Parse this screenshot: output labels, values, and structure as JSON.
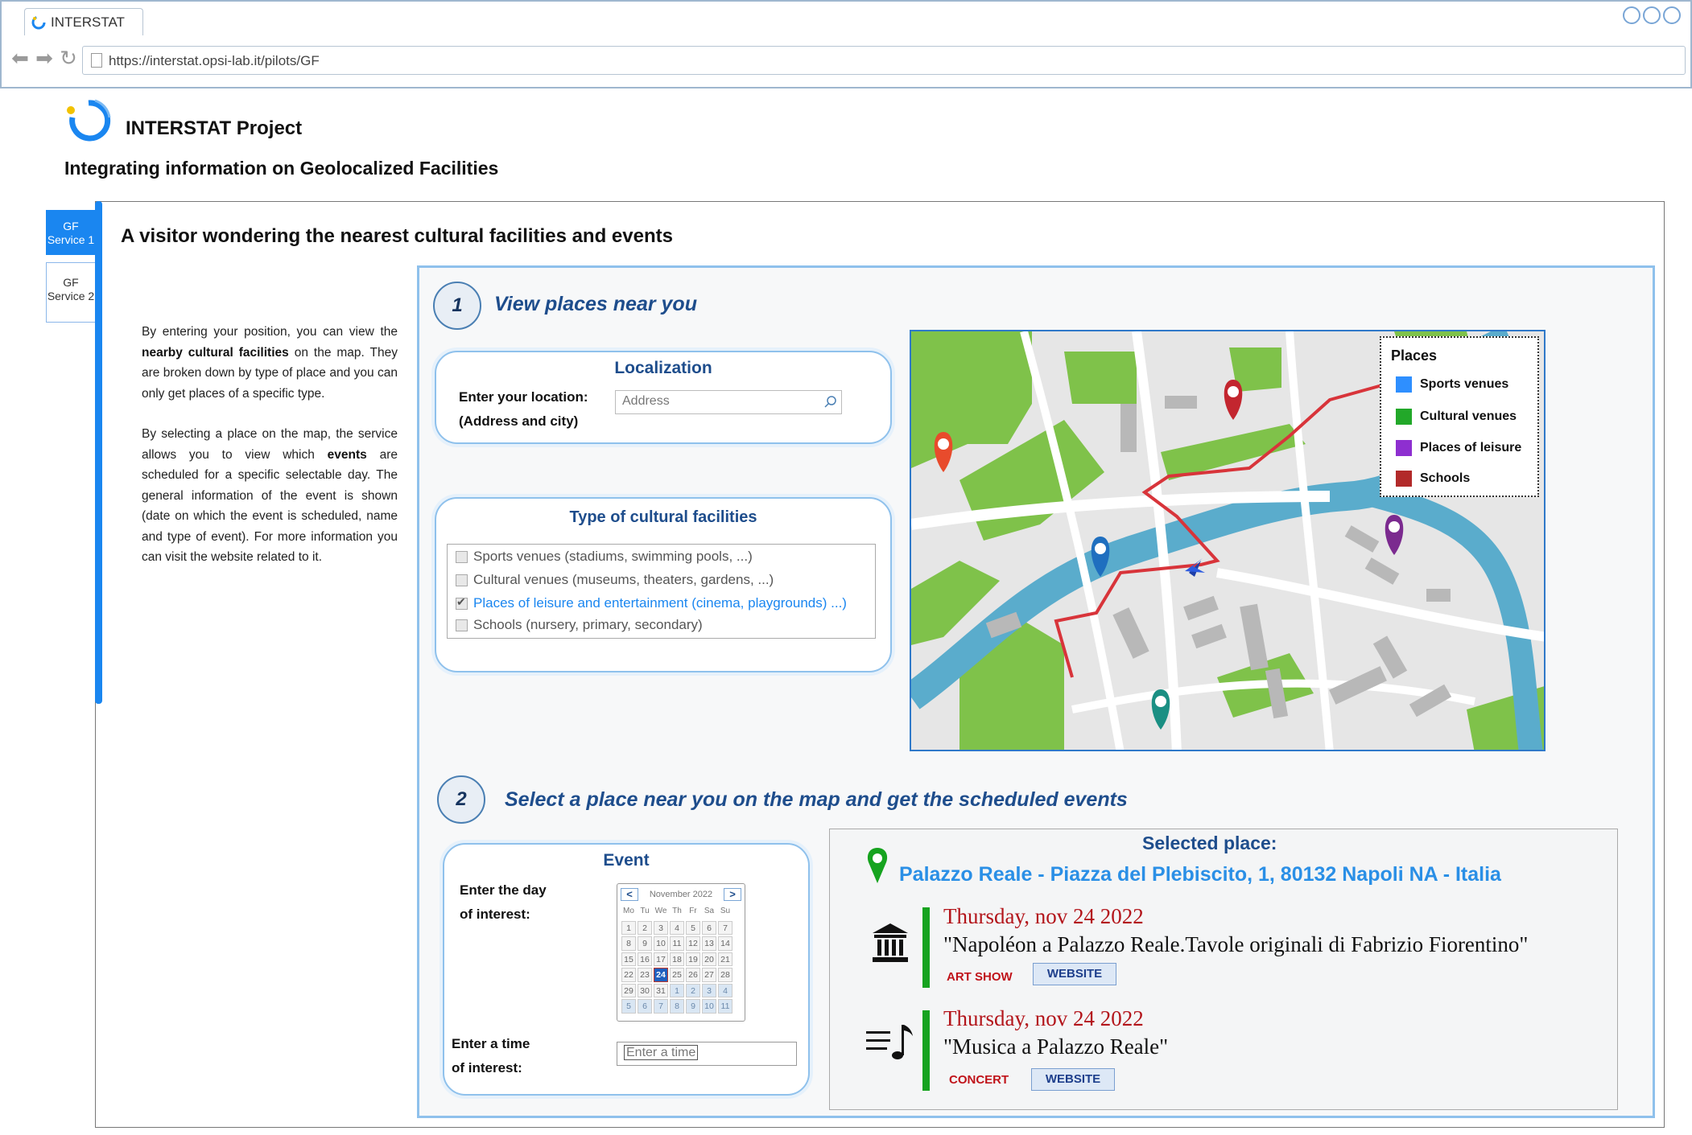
{
  "browser": {
    "tab_title": "INTERSTAT",
    "url": "https://interstat.opsi-lab.it/pilots/GF"
  },
  "header": {
    "project_title": "INTERSTAT Project",
    "subtitle": "Integrating information on Geolocalized Facilities"
  },
  "side_tabs": [
    {
      "label_line1": "GF",
      "label_line2": "Service 1",
      "active": true
    },
    {
      "label_line1": "GF",
      "label_line2": "Service 2",
      "active": false
    }
  ],
  "main": {
    "title": "A visitor wondering the nearest cultural facilities and events",
    "description": {
      "p1_a": "By entering your position, you can view the ",
      "p1_b": "nearby cultural facilities",
      "p1_c": " on the map. They are broken down by type of place and you can only get places of a specific type.",
      "p2_a": "By selecting a place on the map, the service allows you to view which ",
      "p2_b": "events",
      "p2_c": " are scheduled for a specific selectable day. The general information of the event is shown (date on which the event is scheduled, name and type of event). For more information you can visit the website related to it."
    }
  },
  "step1": {
    "number": "1",
    "title": "View places near you",
    "localization": {
      "title": "Localization",
      "label_line1": "Enter your location:",
      "label_line2": "(Address and city)",
      "placeholder": "Address"
    },
    "facilities": {
      "title": "Type of cultural facilities",
      "options": [
        {
          "label": "Sports venues (stadiums, swimming pools, ...)",
          "checked": false
        },
        {
          "label": "Cultural venues (museums, theaters, gardens, ...)",
          "checked": false
        },
        {
          "label": "Places of leisure and entertainment (cinema, playgrounds) ...)",
          "checked": true
        },
        {
          "label": "Schools (nursery, primary, secondary)",
          "checked": false
        }
      ]
    },
    "legend": {
      "title": "Places",
      "items": [
        {
          "label": "Sports venues",
          "color": "#2e8fff"
        },
        {
          "label": "Cultural venues",
          "color": "#22a829"
        },
        {
          "label": "Places of leisure",
          "color": "#8e2fd0"
        },
        {
          "label": "Schools",
          "color": "#b22a2a"
        }
      ]
    }
  },
  "step2": {
    "number": "2",
    "title": "Select a place near you on the map and get the scheduled events",
    "event_box": {
      "title": "Event",
      "day_label_line1": "Enter the day",
      "day_label_line2": "of interest:",
      "time_label_line1": "Enter a time",
      "time_label_line2": "of interest:",
      "time_placeholder": "Enter a time"
    },
    "calendar": {
      "prev": "<",
      "next": ">",
      "month": "November 2022",
      "weekdays": [
        "Mo",
        "Tu",
        "We",
        "Th",
        "Fr",
        "Sa",
        "Su"
      ],
      "days": [
        [
          "1",
          "2",
          "3",
          "4",
          "5",
          "6",
          "7"
        ],
        [
          "8",
          "9",
          "10",
          "11",
          "12",
          "13",
          "14"
        ],
        [
          "15",
          "16",
          "17",
          "18",
          "19",
          "20",
          "21"
        ],
        [
          "22",
          "23",
          "24",
          "25",
          "26",
          "27",
          "28"
        ],
        [
          "29",
          "30",
          "31",
          "1",
          "2",
          "3",
          "4"
        ],
        [
          "5",
          "6",
          "7",
          "8",
          "9",
          "10",
          "11"
        ]
      ],
      "selected_day": "24"
    },
    "selected_place": {
      "label": "Selected place:",
      "name": "Palazzo Reale - Piazza del Plebiscito, 1, 80132 Napoli NA - Italia",
      "events": [
        {
          "date": "Thursday, nov 24 2022",
          "title": "\"Napoléon a Palazzo Reale.Tavole originali di Fabrizio Fiorentino\"",
          "type": "ART SHOW",
          "website": "WEBSITE",
          "icon": "museum-icon"
        },
        {
          "date": "Thursday, nov 24 2022",
          "title": "\"Musica a Palazzo Reale\"",
          "type": "CONCERT",
          "website": "WEBSITE",
          "icon": "music-icon"
        }
      ]
    }
  }
}
